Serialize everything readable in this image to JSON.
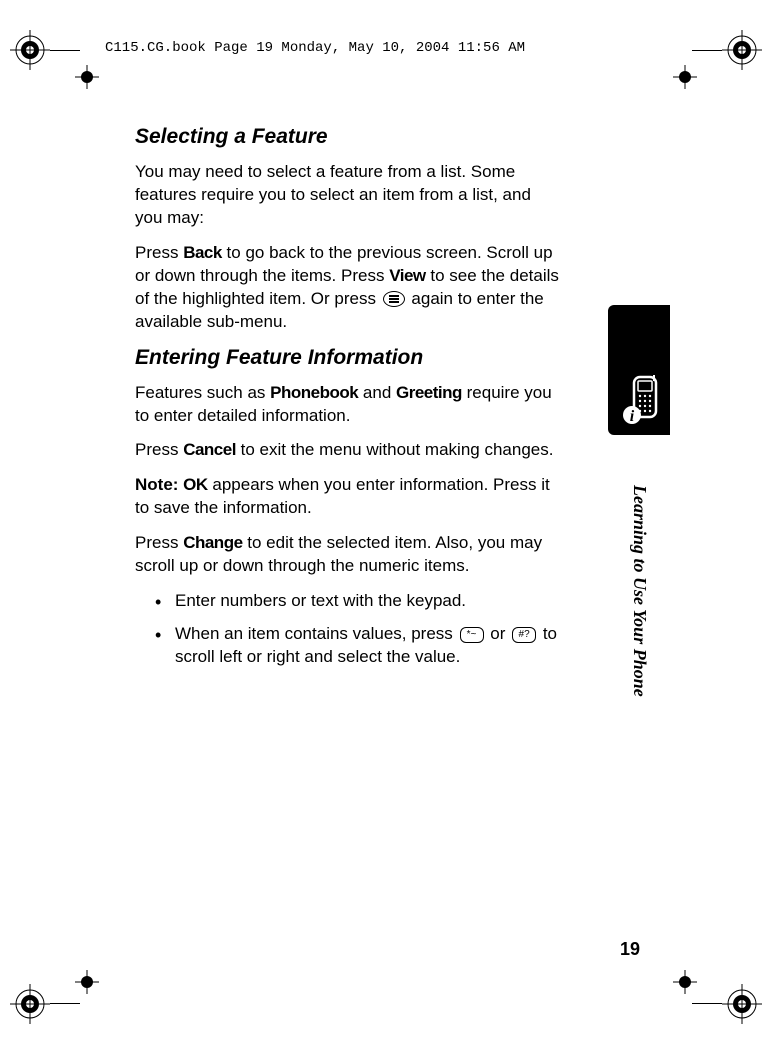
{
  "header": "C115.CG.book  Page 19  Monday, May 10, 2004  11:56 AM",
  "h1": "Selecting a Feature",
  "p1": "You may need to select a feature from a list. Some features require you to select an item from a list, and you may:",
  "p2_part1": "Press ",
  "p2_back": "Back",
  "p2_part2": " to go back to the previous screen. Scroll up or down through the items. Press ",
  "p2_view": "View",
  "p2_part3": " to see the details of the highlighted item. Or press ",
  "p2_part4": " again to enter the available sub-menu.",
  "h2": "Entering Feature Information",
  "p3_part1": "Features such as ",
  "p3_phonebook": "Phonebook",
  "p3_part2": " and ",
  "p3_greeting": "Greeting",
  "p3_part3": " require you to enter detailed information.",
  "p4_part1": "Press ",
  "p4_cancel": "Cancel",
  "p4_part2": " to exit the menu without making changes.",
  "p5_note": "Note: ",
  "p5_ok": "OK",
  "p5_part2": " appears when you enter information. Press it to save the information.",
  "p6_part1": "Press ",
  "p6_change": "Change",
  "p6_part2": " to edit the selected item. Also, you may scroll up or down through the numeric items.",
  "li1": "Enter numbers or text with the keypad.",
  "li2_part1": "When an item contains values, press ",
  "li2_part2": " or ",
  "li2_part3": " to scroll left or right and select the value.",
  "key_star": "*~",
  "key_hash": "#?",
  "side_text": "Learning to Use Your Phone",
  "page_num": "19"
}
